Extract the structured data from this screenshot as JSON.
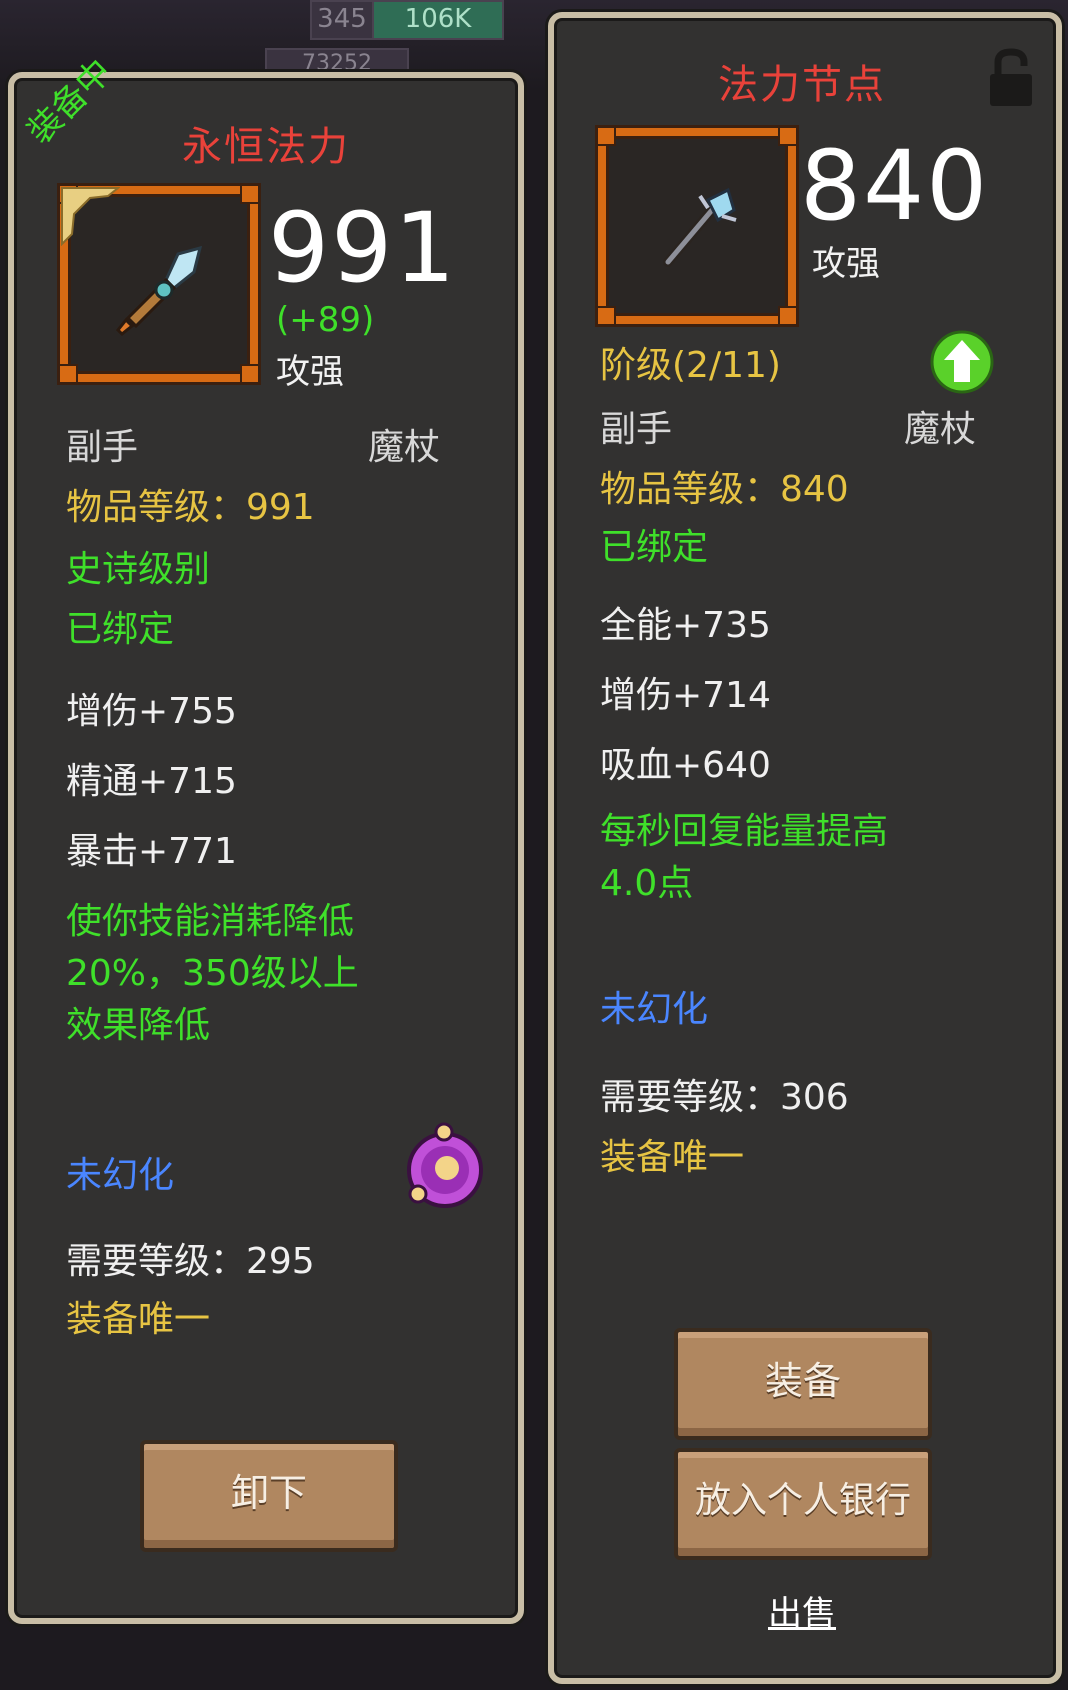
{
  "background": {
    "top_counters": [
      "345",
      "106K",
      "73252"
    ]
  },
  "left_card": {
    "equipped_ribbon": "装备中",
    "title": "永恒法力",
    "score": "991",
    "score_delta": "(+89)",
    "score_label": "攻强",
    "slot": "副手",
    "type": "魔杖",
    "item_level": "物品等级：991",
    "rarity": "史诗级别",
    "bound": "已绑定",
    "stats": [
      "增伤+755",
      "精通+715",
      "暴击+771"
    ],
    "effect": [
      "使你技能消耗降低",
      "20%，350级以上",
      "效果降低"
    ],
    "transmog": "未幻化",
    "required_level": "需要等级：295",
    "unique": "装备唯一",
    "unequip_label": "卸下"
  },
  "right_card": {
    "title": "法力节点",
    "score": "840",
    "score_label": "攻强",
    "tier": "阶级(2/11)",
    "slot": "副手",
    "type": "魔杖",
    "item_level": "物品等级：840",
    "bound": "已绑定",
    "stats": [
      "全能+735",
      "增伤+714",
      "吸血+640"
    ],
    "effect": [
      "每秒回复能量提高",
      "4.0点"
    ],
    "transmog": "未幻化",
    "required_level": "需要等级：306",
    "unique": "装备唯一",
    "equip_label": "装备",
    "bank_label": "放入个人银行",
    "sell_label": "出售"
  },
  "colors": {
    "title_red": "#e9423a",
    "yellow": "#e7c443",
    "green": "#3fe02a",
    "blue": "#4a86ff",
    "frame_orange": "#d86b14",
    "panel_border": "#c9bea6"
  },
  "icons": [
    "wand-icon",
    "staff-icon",
    "lock-icon",
    "upgrade-arrow-icon",
    "transmog-orb-icon"
  ]
}
